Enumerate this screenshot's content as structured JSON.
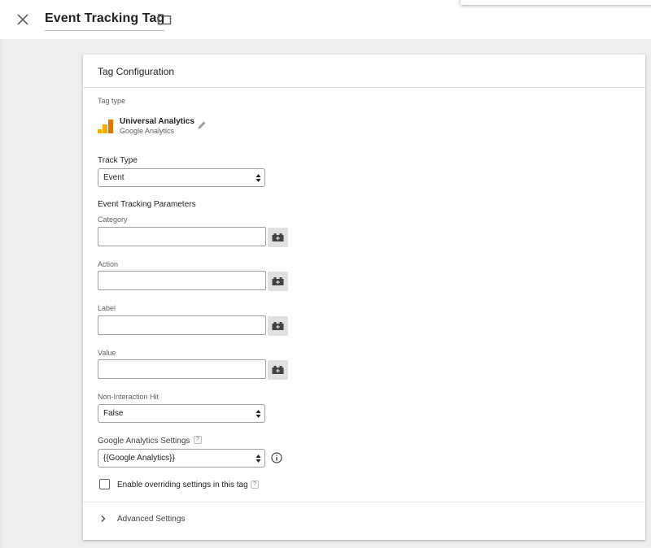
{
  "header": {
    "tag_name": "Event Tracking Tag",
    "close_icon": "close-icon",
    "folder_icon": "folder-icon"
  },
  "card": {
    "title": "Tag Configuration",
    "tag_type": {
      "label": "Tag type",
      "name": "Universal Analytics",
      "vendor": "Google Analytics",
      "logo_colors": [
        "#F9AB00",
        "#F9AB00",
        "#E37400"
      ]
    },
    "track_type": {
      "label": "Track Type",
      "value": "Event"
    },
    "event_params": {
      "heading": "Event Tracking Parameters",
      "fields": [
        {
          "label": "Category",
          "value": ""
        },
        {
          "label": "Action",
          "value": ""
        },
        {
          "label": "Label",
          "value": ""
        },
        {
          "label": "Value",
          "value": ""
        }
      ]
    },
    "non_interaction": {
      "label": "Non-Interaction Hit",
      "value": "False"
    },
    "ga_settings": {
      "label": "Google Analytics Settings",
      "help": "?",
      "value": "{{Google Analytics}}"
    },
    "override": {
      "label": "Enable overriding settings in this tag",
      "help": "?",
      "checked": false
    },
    "advanced": {
      "label": "Advanced Settings"
    }
  }
}
